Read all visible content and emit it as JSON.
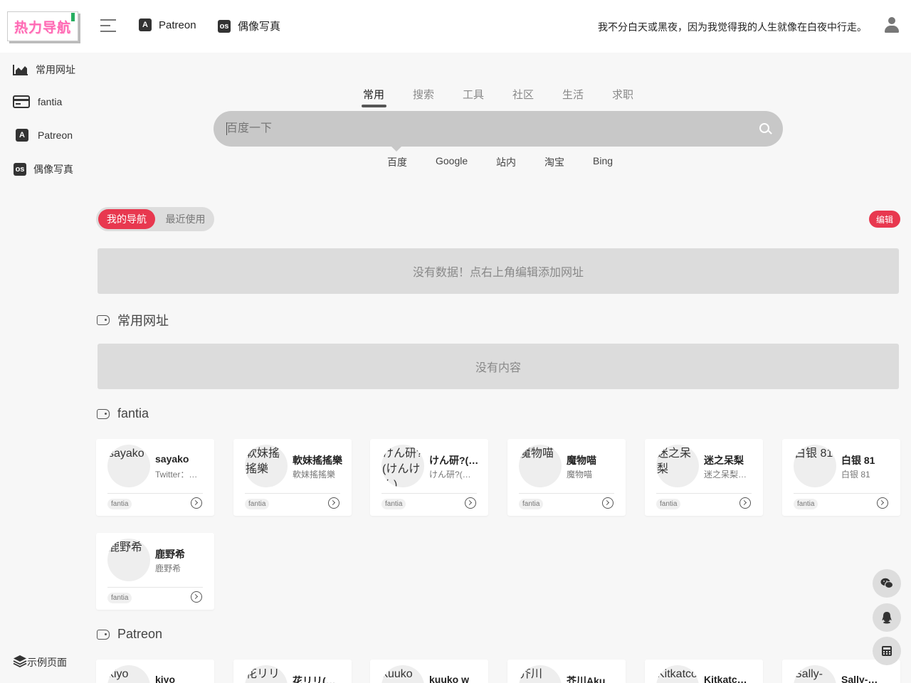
{
  "header": {
    "logo_text": "热力导航",
    "nav": [
      {
        "label": "Patreon",
        "icon": "patreon-icon",
        "icon_glyph": "A"
      },
      {
        "label": "偶像写真",
        "icon": "lastfm-icon",
        "icon_glyph": "os"
      }
    ],
    "quote": "我不分白天或黑夜，因为我觉得我的人生就像在白夜中行走。"
  },
  "sidebar": {
    "items": [
      {
        "label": "常用网址",
        "icon": "area-chart-icon"
      },
      {
        "label": "fantia",
        "icon": "credit-card-icon"
      },
      {
        "label": "Patreon",
        "icon": "patreon-icon",
        "icon_glyph": "A"
      },
      {
        "label": "偶像写真",
        "icon": "lastfm-icon",
        "icon_glyph": "os"
      }
    ],
    "bottom": {
      "label": "示例页面",
      "icon": "layers-icon"
    }
  },
  "search": {
    "tabs": [
      "常用",
      "搜索",
      "工具",
      "社区",
      "生活",
      "求职"
    ],
    "active_tab": "常用",
    "placeholder": "百度一下",
    "engines": [
      "百度",
      "Google",
      "站内",
      "淘宝",
      "Bing"
    ],
    "active_engine": "百度"
  },
  "mynav": {
    "tabs": [
      "我的导航",
      "最近使用"
    ],
    "active": "我的导航",
    "edit_label": "编辑",
    "empty_text": "没有数据！点右上角编辑添加网址"
  },
  "sections": {
    "common": {
      "title": "常用网址",
      "empty_text": "没有内容"
    },
    "fantia": {
      "title": "fantia",
      "cards": [
        {
          "avatar_alt": "sayako",
          "name": "sayako",
          "desc": "Twitter：…",
          "tag": "fantia"
        },
        {
          "avatar_alt": "軟妹搖搖樂",
          "name": "軟妹搖搖樂",
          "desc": "軟妹搖搖樂",
          "tag": "fantia"
        },
        {
          "avatar_alt": "けん研? (けんけん)",
          "name": "けん研?(けんけん)",
          "desc": "けん研?(…",
          "tag": "fantia"
        },
        {
          "avatar_alt": "魔物喵",
          "name": "魔物喵",
          "desc": "魔物喵",
          "tag": "fantia"
        },
        {
          "avatar_alt": "迷之呆梨",
          "name": "迷之呆梨",
          "desc": "迷之呆梨…",
          "tag": "fantia"
        },
        {
          "avatar_alt": "白银 81",
          "name": "白银 81",
          "desc": "白银 81",
          "tag": "fantia"
        },
        {
          "avatar_alt": "鹿野希",
          "name": "鹿野希",
          "desc": "鹿野希",
          "tag": "fantia"
        }
      ]
    },
    "patreon": {
      "title": "Patreon",
      "cards": [
        {
          "avatar_alt": "kiyo",
          "name": "kiyo"
        },
        {
          "avatar_alt": "花リリ",
          "name": "花リリ(…"
        },
        {
          "avatar_alt": "kuuko",
          "name": "kuuko w"
        },
        {
          "avatar_alt": "芥川",
          "name": "芥川Aku"
        },
        {
          "avatar_alt": "Kitkatcos",
          "name": "Kitkatc…"
        },
        {
          "avatar_alt": "Sally-",
          "name": "Sally-…"
        }
      ]
    }
  },
  "floating": [
    "wechat-icon",
    "qq-icon",
    "calculator-icon"
  ]
}
